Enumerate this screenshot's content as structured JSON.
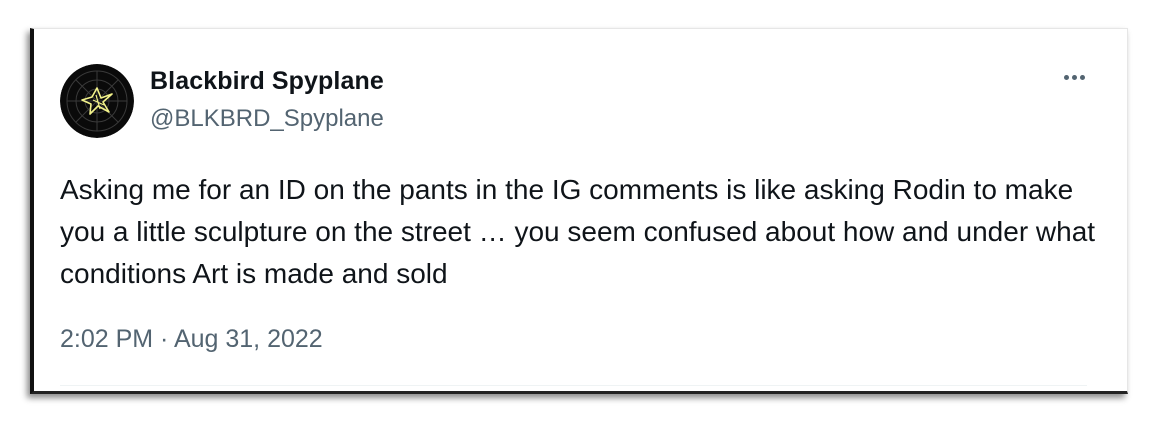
{
  "tweet": {
    "author": {
      "display_name": "Blackbird Spyplane",
      "handle": "@BLKBRD_Spyplane",
      "avatar_icon": "radar-bird-avatar-icon"
    },
    "more_icon": "more-options-icon",
    "text": "Asking me for an ID on the pants in the IG comments is like asking Rodin to make you a little sculpture on the street … you seem confused about how and under what conditions Art is made and sold",
    "timestamp": "2:02 PM · Aug 31, 2022"
  },
  "colors": {
    "primary_text": "#0f1419",
    "secondary_text": "#536471",
    "avatar_bg": "#0a0a0a",
    "avatar_accent": "#f2f28a"
  }
}
